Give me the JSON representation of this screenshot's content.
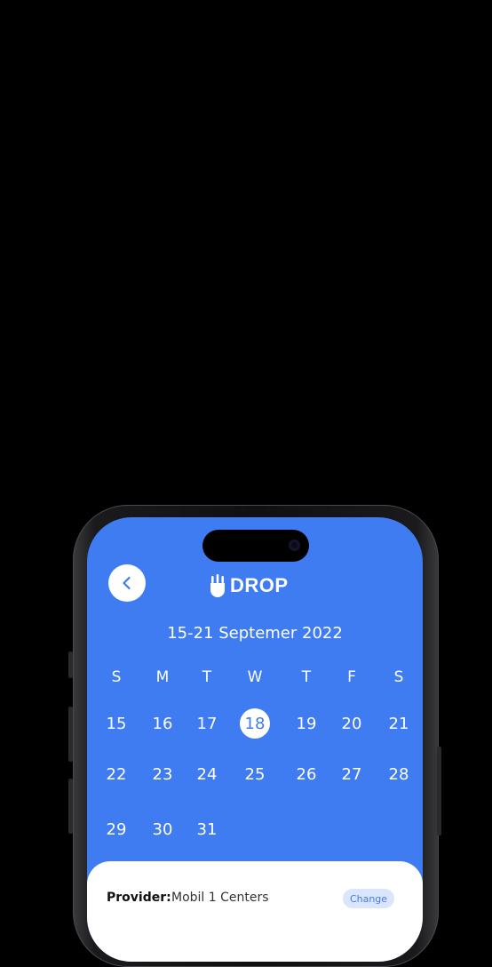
{
  "header": {
    "back_icon": "chevron-left-icon",
    "logo_icon": "drop-hand-icon",
    "logo_text": "DROP"
  },
  "calendar": {
    "week_label": "15-21 Septemer 2022",
    "weekdays": [
      "S",
      "M",
      "T",
      "W",
      "T",
      "F",
      "S"
    ],
    "rows": [
      [
        "15",
        "16",
        "17",
        "18",
        "19",
        "20",
        "21"
      ],
      [
        "22",
        "23",
        "24",
        "25",
        "26",
        "27",
        "28"
      ],
      [
        "29",
        "30",
        "31"
      ]
    ],
    "selected_day": "18"
  },
  "details": {
    "provider_label": "Provider:",
    "provider_value": "Mobil 1 Centers",
    "change_label": "Change"
  },
  "colors": {
    "accent": "#3f7bf1",
    "background": "#000000",
    "card": "#ffffff",
    "change_bg": "#dbe6fd"
  }
}
